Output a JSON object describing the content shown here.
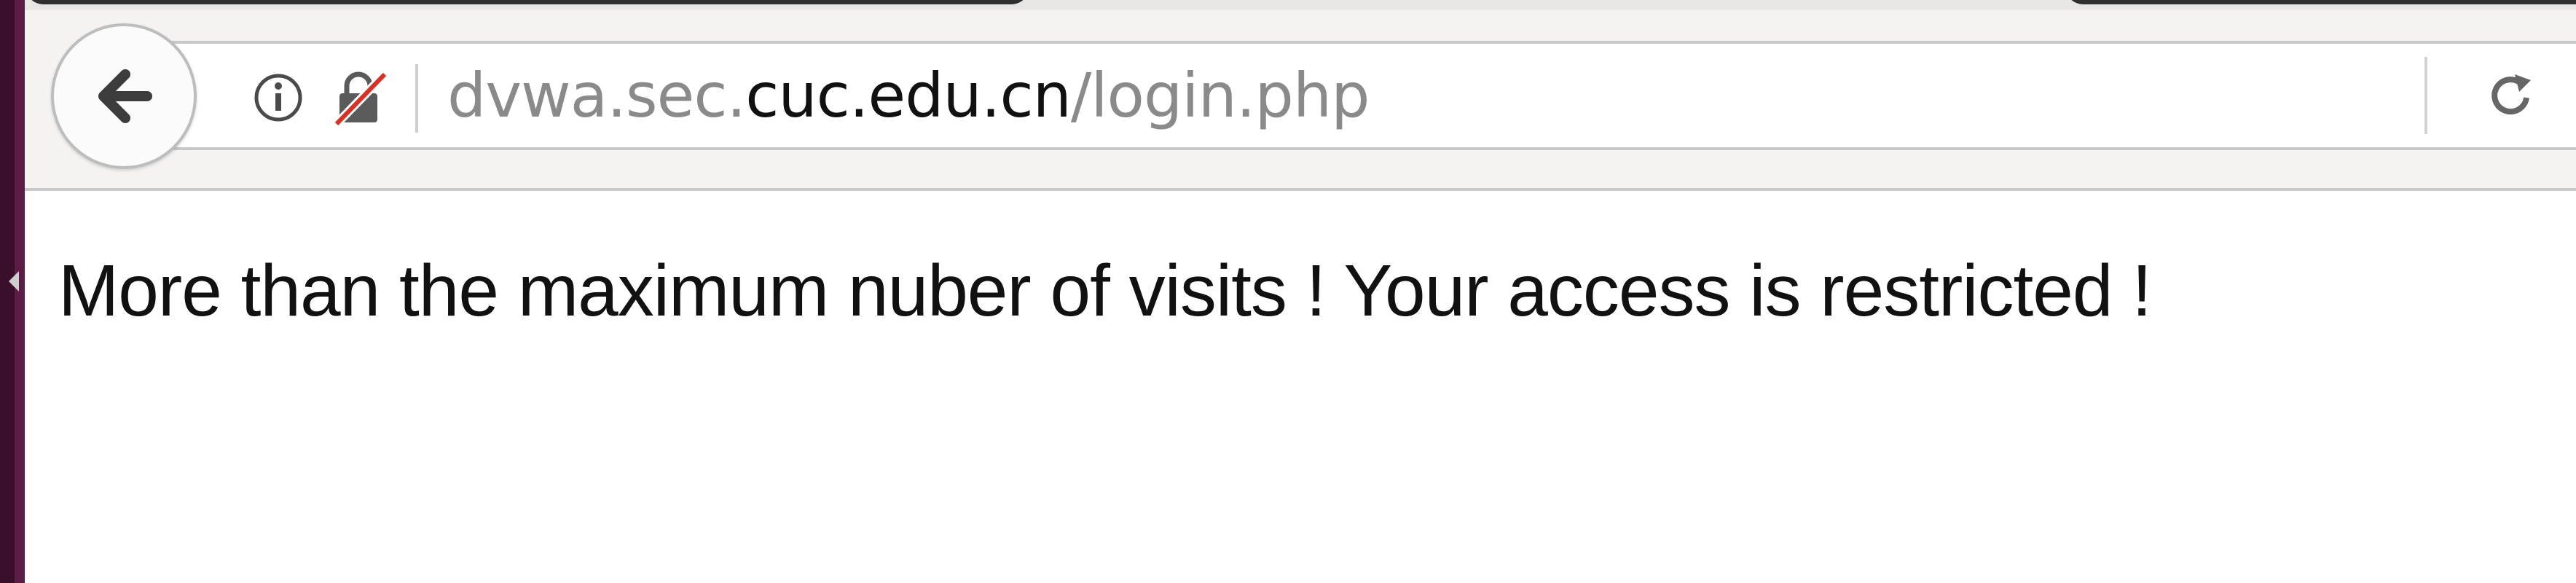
{
  "browser": {
    "url": {
      "prefix": "dvwa.sec.",
      "host": "cuc.edu.cn",
      "path": "/login.php"
    },
    "icons": {
      "back": "back-arrow-icon",
      "info": "info-icon",
      "security": "insecure-connection-icon",
      "reload": "reload-icon"
    },
    "colors": {
      "insecure_slash": "#d93025",
      "window_edge": "#3a0f2c"
    }
  },
  "page": {
    "message": "More than the maximum nuber of visits ! Your access is restricted !"
  }
}
